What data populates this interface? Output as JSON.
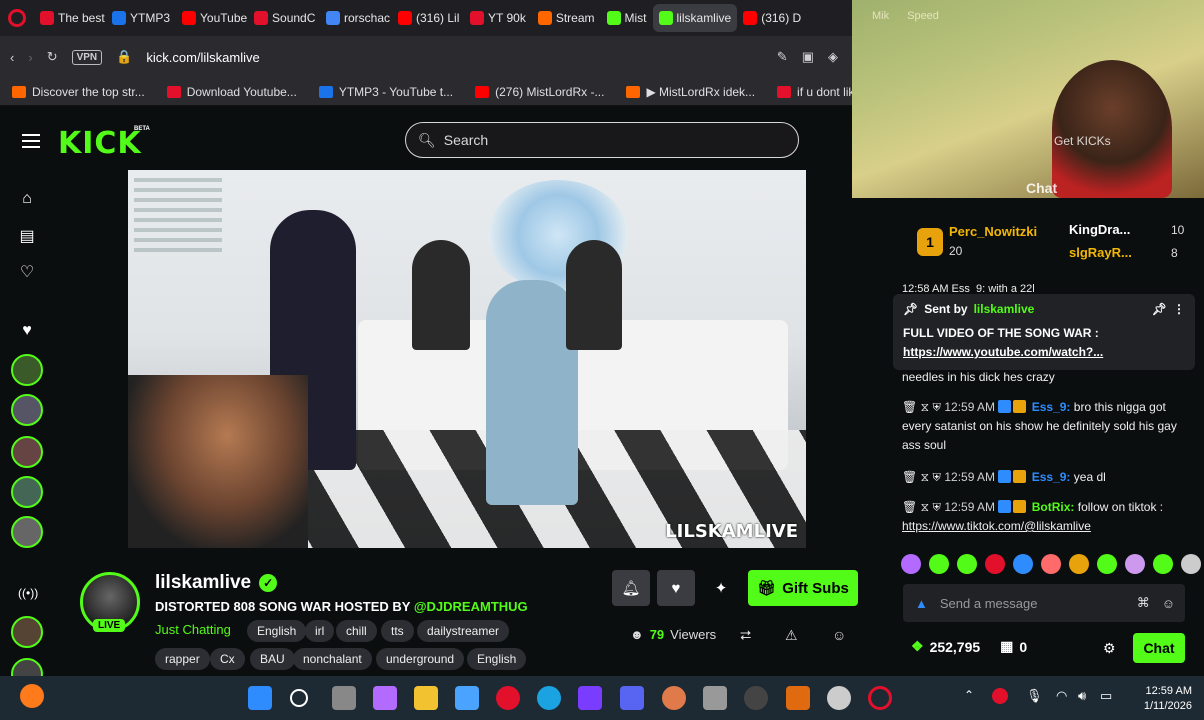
{
  "browser": {
    "tabs": [
      {
        "label": "The best",
        "color": "#e3102b"
      },
      {
        "label": "YTMP3",
        "color": "#1a73e8"
      },
      {
        "label": "YouTube",
        "color": "#ff0000"
      },
      {
        "label": "SoundC",
        "color": "#e3102b"
      },
      {
        "label": "rorschac",
        "color": "#4285f4"
      },
      {
        "label": "(316) Lil",
        "color": "#ff0000"
      },
      {
        "label": "YT 90k",
        "color": "#e3102b"
      },
      {
        "label": "Stream",
        "color": "#ff6600"
      },
      {
        "label": "Mist",
        "color": "#53fc18"
      },
      {
        "label": "lilskamlive",
        "color": "#53fc18"
      },
      {
        "label": "(316) D",
        "color": "#ff0000"
      }
    ],
    "url": "kick.com/lilskamlive",
    "vpn": "VPN",
    "bookmarks": [
      {
        "label": "Discover the top str...",
        "color": "#ff6600"
      },
      {
        "label": "Download Youtube...",
        "color": "#e3102b"
      },
      {
        "label": "YTMP3 - YouTube t...",
        "color": "#1a73e8"
      },
      {
        "label": "(276) MistLordRx -...",
        "color": "#ff0000"
      },
      {
        "label": "▶ MistLordRx idek...",
        "color": "#ff6600"
      },
      {
        "label": "if u dont likeit you b...",
        "color": "#e3102b"
      }
    ]
  },
  "header": {
    "logo": "KICK",
    "beta": "BETA",
    "search_placeholder": "Search"
  },
  "video": {
    "watermark": "LILSKAMLIVE"
  },
  "channel": {
    "name": "lilskamlive",
    "live": "LIVE",
    "title": "DISTORTED 808 SONG WAR HOSTED BY",
    "host": "@DJDREAMTHUG",
    "category": "Just Chatting",
    "tags": [
      "English",
      "irl",
      "chill",
      "tts",
      "dailystreamer",
      "rapper",
      "Cx",
      "BAU",
      "nonchalant",
      "underground",
      "English"
    ],
    "gift_label": "Gift Subs",
    "viewer_count": "79",
    "viewers_label": "Viewers"
  },
  "webcam": {
    "tabs": [
      "Mik",
      "Speed"
    ],
    "get_kicks": "Get KICKs",
    "chat": "Chat"
  },
  "chat": {
    "leaderboard": {
      "rank": "1",
      "first": {
        "name": "Perc_Nowitzki",
        "points": "20"
      },
      "second": {
        "name": "KingDra...",
        "points": "10"
      },
      "third": {
        "name": "slgRayR...",
        "points": "8"
      }
    },
    "partial_line": "12:58 AM  Ess_9: with a 22l",
    "pinned": {
      "sent_by": "Sent by",
      "user": "lilskamlive",
      "message": "FULL VIDEO OF THE SONG WAR :",
      "link": "https://www.youtube.com/watch?..."
    },
    "partial_text": "needles in his dick hes crazy",
    "messages": [
      {
        "time": "12:59 AM",
        "user": "Ess_9:",
        "user_color": "#2f8cff",
        "text": "bro this nigga got every satanist on his show he definitely sold his gay ass soul"
      },
      {
        "time": "12:59 AM",
        "user": "Ess_9:",
        "user_color": "#2f8cff",
        "text": "yea dl"
      },
      {
        "time": "12:59 AM",
        "user": "BotRix:",
        "user_color": "#53fc18",
        "text": "follow on tiktok :",
        "link": "https://www.tiktok.com/@lilskamlive"
      }
    ],
    "send_placeholder": "Send a message",
    "points": "252,795",
    "zero": "0",
    "chat_button": "Chat"
  },
  "taskbar": {
    "time": "12:59 AM",
    "date": "1/11/2026"
  }
}
